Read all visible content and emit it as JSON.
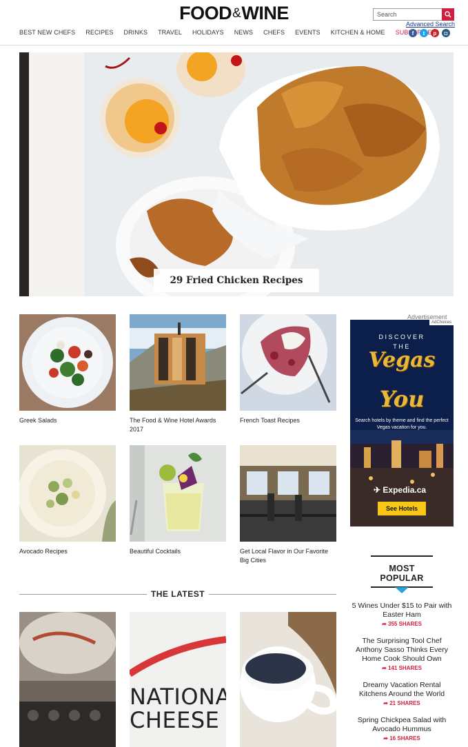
{
  "header": {
    "logo_left": "FOOD",
    "logo_amp": "&",
    "logo_right": "WINE",
    "search_placeholder": "Search",
    "advanced_search": "Advanced Search",
    "nav": [
      "BEST NEW CHEFS",
      "RECIPES",
      "DRINKS",
      "TRAVEL",
      "HOLIDAYS",
      "NEWS",
      "CHEFS",
      "EVENTS",
      "KITCHEN & HOME",
      "SUBSCRIBE"
    ],
    "social": [
      "facebook",
      "twitter",
      "pinterest",
      "instagram"
    ]
  },
  "hero": {
    "caption": "29 Fried Chicken Recipes"
  },
  "grid": [
    {
      "label": "Greek Salads"
    },
    {
      "label": "The Food & Wine Hotel Awards 2017"
    },
    {
      "label": "French Toast Recipes"
    },
    {
      "label": "Avocado Recipes"
    },
    {
      "label": "Beautiful Cocktails"
    },
    {
      "label": "Get Local Flavor in Our Favorite Big Cities"
    }
  ],
  "latest": {
    "title": "THE LATEST",
    "cheese_text_1": "NATIONA",
    "cheese_text_2": "CHEESE D"
  },
  "ad": {
    "label": "Advertisement",
    "adchoices": "AdChoices",
    "discover": "DISCOVER",
    "the": "THE",
    "vegas": "Vegas",
    "you": "You",
    "pitch": "Search hotels by theme and find the perfect Vegas vacation for you.",
    "brand": "Expedia.ca",
    "cta": "See Hotels"
  },
  "most_popular": {
    "title_1": "MOST",
    "title_2": "POPULAR",
    "items": [
      {
        "title": "5 Wines Under $15 to Pair with Easter Ham",
        "shares": "355 SHARES"
      },
      {
        "title": "The Surprising Tool Chef Anthony Sasso Thinks Every Home Cook Should Own",
        "shares": "141 SHARES"
      },
      {
        "title": "Dreamy Vacation Rental Kitchens Around the World",
        "shares": "21 SHARES"
      },
      {
        "title": "Spring Chickpea Salad with Avocado Hummus",
        "shares": "16 SHARES"
      }
    ]
  },
  "colors": {
    "brand_red": "#d11f3f",
    "link_blue": "#1a3d8f"
  }
}
